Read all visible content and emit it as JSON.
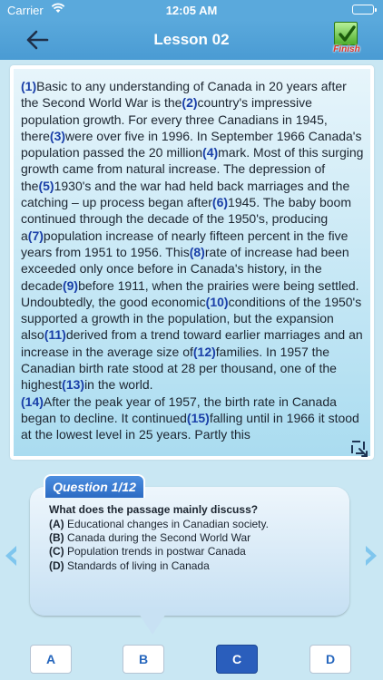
{
  "status": {
    "carrier": "Carrier",
    "time": "12:05 AM"
  },
  "nav": {
    "title": "Lesson 02",
    "finish_label": "Finish"
  },
  "passage": {
    "segments": [
      {
        "num": "(1)",
        "text": "Basic to any understanding of Canada in 20 years after the Second World War is the"
      },
      {
        "num": "(2)",
        "text": "country's impressive population growth. For every three Canadians in 1945, there"
      },
      {
        "num": "(3)",
        "text": "were over five in 1996. In September 1966 Canada's population passed the 20 million"
      },
      {
        "num": "(4)",
        "text": "mark. Most of this surging growth came from natural increase. The depression of the"
      },
      {
        "num": "(5)",
        "text": "1930's and the war had held back marriages and the catching – up process began after"
      },
      {
        "num": "(6)",
        "text": "1945. The baby boom continued through the decade of the 1950's, producing a"
      },
      {
        "num": "(7)",
        "text": "population increase of nearly fifteen percent in the five years from 1951 to 1956. This"
      },
      {
        "num": "(8)",
        "text": "rate of increase had been exceeded only once before in Canada's history, in the decade"
      },
      {
        "num": "(9)",
        "text": "before 1911, when the prairies were being settled. Undoubtedly, the good economic"
      },
      {
        "num": "(10)",
        "text": "conditions of the 1950's supported a growth in the population, but the expansion also"
      },
      {
        "num": "(11)",
        "text": "derived from a trend toward earlier marriages and an increase in the average size of"
      },
      {
        "num": "(12)",
        "text": "families. In 1957 the Canadian birth rate stood at 28 per thousand, one of the highest"
      },
      {
        "num": "(13)",
        "text": "in the world."
      },
      {
        "num": "(14)",
        "text": "After the peak year of 1957, the birth rate in Canada began to decline. It continued"
      },
      {
        "num": "(15)",
        "text": "falling until in 1966 it stood at the lowest level in 25 years. Partly this"
      }
    ]
  },
  "question": {
    "header": "Question 1/12",
    "prompt": "What does the passage mainly discuss?",
    "choices": [
      {
        "letter": "(A)",
        "text": " Educational changes in Canadian society."
      },
      {
        "letter": "(B)",
        "text": " Canada during the Second World War"
      },
      {
        "letter": "(C)",
        "text": " Population trends in postwar Canada"
      },
      {
        "letter": "(D)",
        "text": " Standards of living in Canada"
      }
    ]
  },
  "answers": {
    "options": [
      "A",
      "B",
      "C",
      "D"
    ],
    "selected": "C"
  },
  "colors": {
    "accent": "#4a9bd3",
    "number_highlight": "#1a3fa8",
    "selected_answer": "#2a5ebc"
  },
  "icons": {
    "back": "arrow-left-icon",
    "finish": "checkmark-icon",
    "expand": "expand-icon",
    "prev": "chevron-left-icon",
    "next": "chevron-right-icon"
  }
}
